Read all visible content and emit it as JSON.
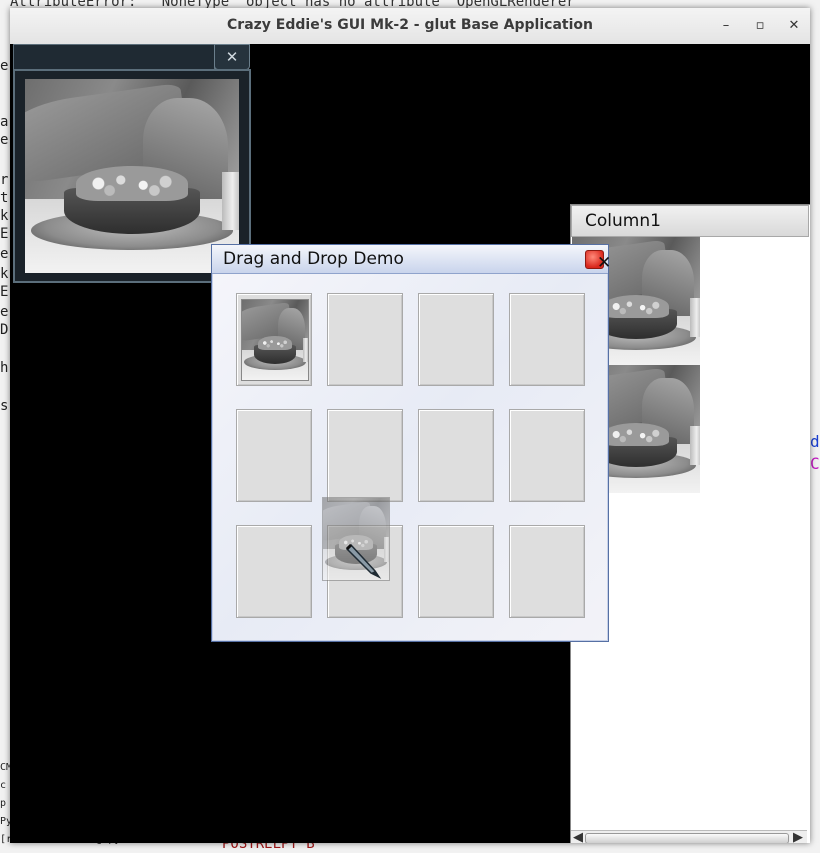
{
  "background_terminal": {
    "top_line": "AttributeError: \"'NoneType' object has no attribute 'OpenGLRenderer'\"",
    "left_fragments": [
      "e",
      "a",
      "e",
      "r",
      "t",
      "k",
      "E",
      "e",
      "k",
      "E",
      "e",
      "D",
      "h",
      "s"
    ],
    "right_fragments": [
      "d",
      "C"
    ],
    "bottom_fragments": [
      "CM",
      "c",
      "p",
      "Py",
      "[r/test/embedding.py..."
    ],
    "bottom_text": "POSTRELPT B"
  },
  "window": {
    "title": "Crazy Eddie's GUI Mk-2 - glut Base Application",
    "minimize_label": "–",
    "maximize_label": "▫",
    "close_label": "✕"
  },
  "image_frame": {
    "close_label": "✕"
  },
  "list_widget": {
    "column_header": "Column1",
    "scroll_left": "◀",
    "scroll_right": "▶",
    "rows": 2
  },
  "dialog": {
    "title": "Drag and Drop Demo",
    "close_label": "✕",
    "grid": {
      "rows": 3,
      "cols": 4,
      "filled_slot": 0
    }
  },
  "icons": {
    "window_close": "close-icon",
    "dialog_close": "close-icon",
    "cursor": "pen-cursor-icon"
  },
  "colors": {
    "canvas": "#000000",
    "dialog_border": "#5670a4",
    "dialog_close": "#d8261c",
    "frame_border": "#5b6e7b"
  }
}
